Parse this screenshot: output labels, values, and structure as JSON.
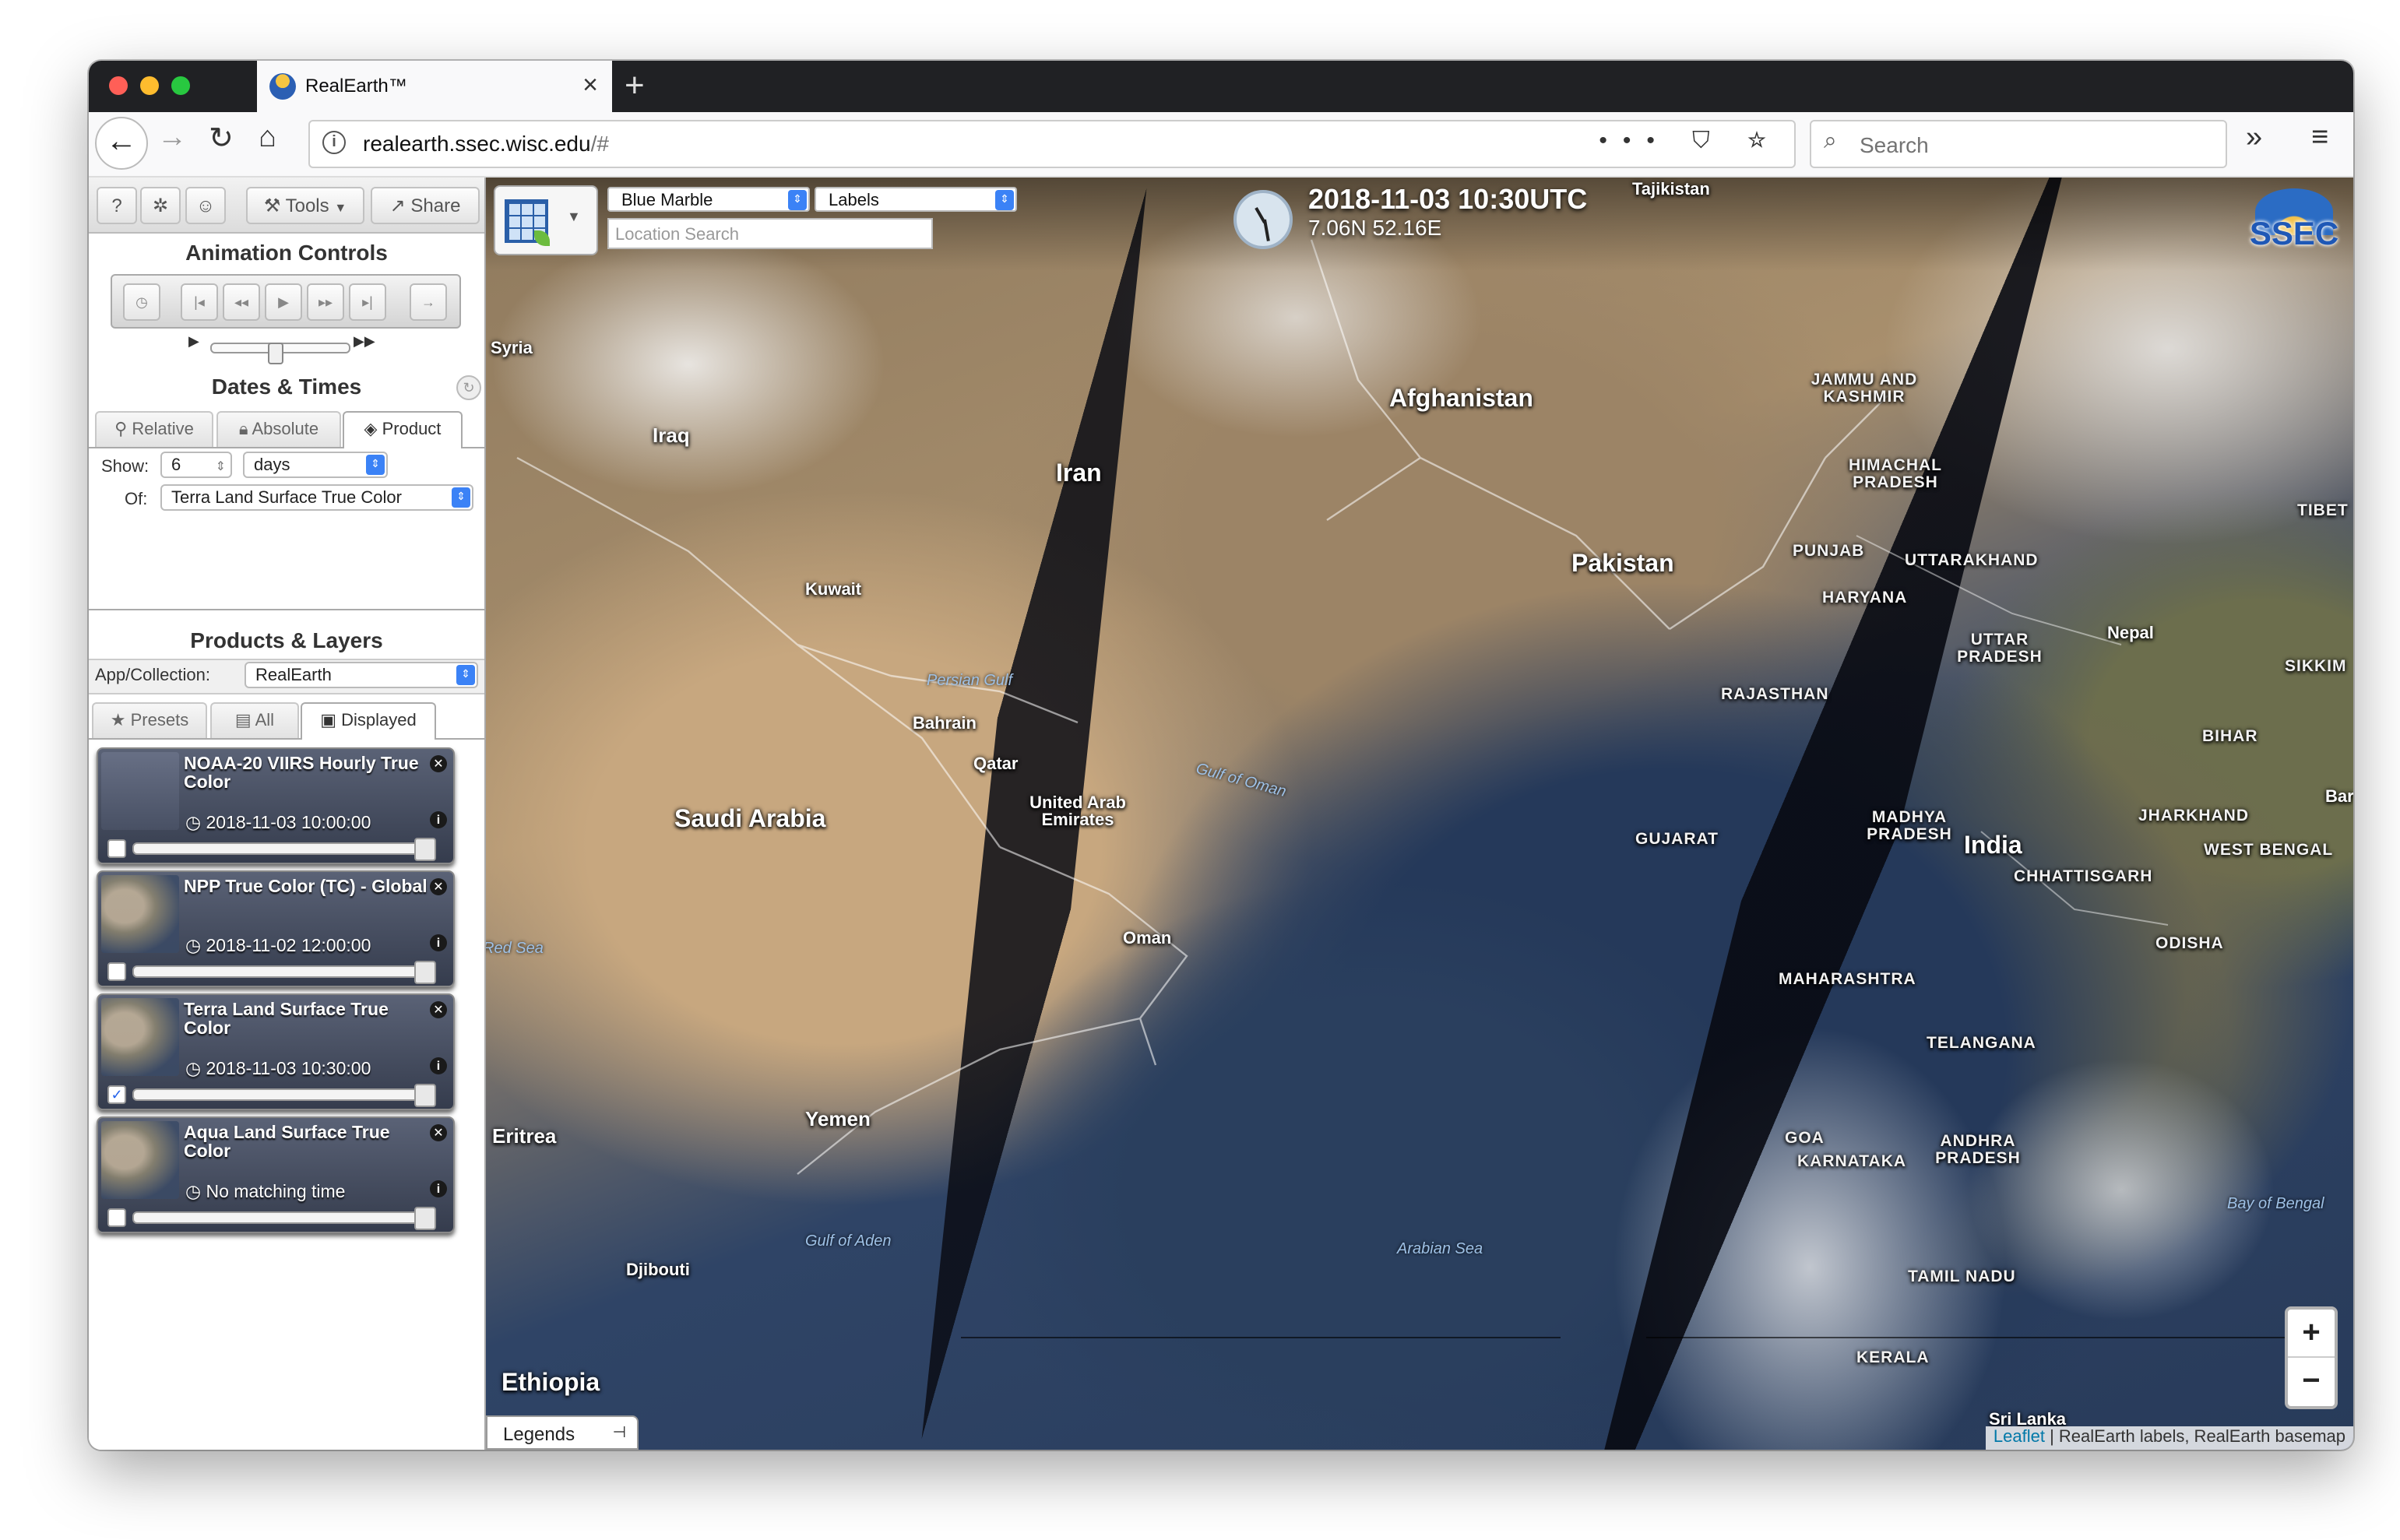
{
  "browser": {
    "tab_title": "RealEarth™",
    "new_tab_icon": "plus",
    "url_host": "realearth.ssec.wisc.edu",
    "url_rest": "/#",
    "url_actions": "••• ⛉ ☆",
    "search_placeholder": "Search",
    "back_icon": "←",
    "forward_icon": "→",
    "reload_icon": "↻",
    "home_icon": "⌂",
    "overflow_icon": "»",
    "menu_icon": "≡"
  },
  "toolbar": {
    "help": "?",
    "settings": "✲",
    "user": "☺",
    "tools_label": "Tools",
    "share_label": "Share"
  },
  "animation": {
    "title": "Animation Controls",
    "speed_value": 0.45
  },
  "dates": {
    "title": "Dates & Times",
    "tabs": [
      "Relative",
      "Absolute",
      "Product"
    ],
    "active_tab": "Product",
    "show_label": "Show:",
    "show_value": "6",
    "unit_value": "days",
    "of_label": "Of:",
    "of_value": "Terra Land Surface True Color"
  },
  "products": {
    "title": "Products & Layers",
    "app_label": "App/Collection:",
    "app_value": "RealEarth",
    "tabs": [
      "Presets",
      "All",
      "Displayed"
    ],
    "active_tab": "Displayed",
    "layers": [
      {
        "name": "NOAA-20 VIIRS Hourly True Color",
        "time": "2018-11-03 10:00:00",
        "checked": false
      },
      {
        "name": "NPP True Color (TC) - Global",
        "time": "2018-11-02 12:00:00",
        "checked": false
      },
      {
        "name": "Terra Land Surface True Color",
        "time": "2018-11-03 10:30:00",
        "checked": true
      },
      {
        "name": "Aqua Land Surface True Color",
        "time": "No matching time",
        "checked": false
      }
    ]
  },
  "map": {
    "basemap": "Blue Marble",
    "overlay": "Labels",
    "location_placeholder": "Location Search",
    "datetime": "2018-11-03 10:30UTC",
    "coords": "7.06N 52.16E",
    "logo": "SSEC",
    "zoom_in": "+",
    "zoom_out": "−",
    "legends": "Legends",
    "attribution_link": "Leaflet",
    "attribution_text": " | RealEarth labels, RealEarth basemap",
    "labels": {
      "tajikistan": "Tajikistan",
      "syria": "Syria",
      "iraq": "Iraq",
      "iran": "Iran",
      "afghanistan": "Afghanistan",
      "pakistan": "Pakistan",
      "kuwait": "Kuwait",
      "bahrain": "Bahrain",
      "qatar": "Qatar",
      "uae": "United Arab Emirates",
      "saudi": "Saudi Arabia",
      "oman": "Oman",
      "yemen": "Yemen",
      "eritrea": "Eritrea",
      "djibouti": "Djibouti",
      "ethiopia": "Ethiopia",
      "india": "India",
      "nepal": "Nepal",
      "tibet": "TIBET",
      "sikkim": "SIKKIM",
      "bar": "Bar",
      "jammu": "JAMMU AND KASHMIR",
      "himachal": "HIMACHAL PRADESH",
      "punjab": "PUNJAB",
      "uttarakhand": "UTTARAKHAND",
      "haryana": "HARYANA",
      "uttarpradesh": "UTTAR PRADESH",
      "rajasthan": "RAJASTHAN",
      "bihar": "BIHAR",
      "gujarat": "GUJARAT",
      "madhya": "MADHYA PRADESH",
      "jharkhand": "JHARKHAND",
      "westbengal": "WEST BENGAL",
      "chhattisgarh": "CHHATTISGARH",
      "odisha": "ODISHA",
      "maharashtra": "MAHARASHTRA",
      "telangana": "TELANGANA",
      "goa": "GOA",
      "karnataka": "KARNATAKA",
      "andhra": "ANDHRA PRADESH",
      "tamilnadu": "TAMIL NADU",
      "kerala": "KERALA",
      "srilanka": "Sri Lanka",
      "persiangulf": "Persian Gulf",
      "gulfofoman": "Gulf of Oman",
      "gulfofaden": "Gulf of Aden",
      "arabiansea": "Arabian Sea",
      "bayofbengal": "Bay of Bengal",
      "redsea": "Red Sea"
    }
  }
}
